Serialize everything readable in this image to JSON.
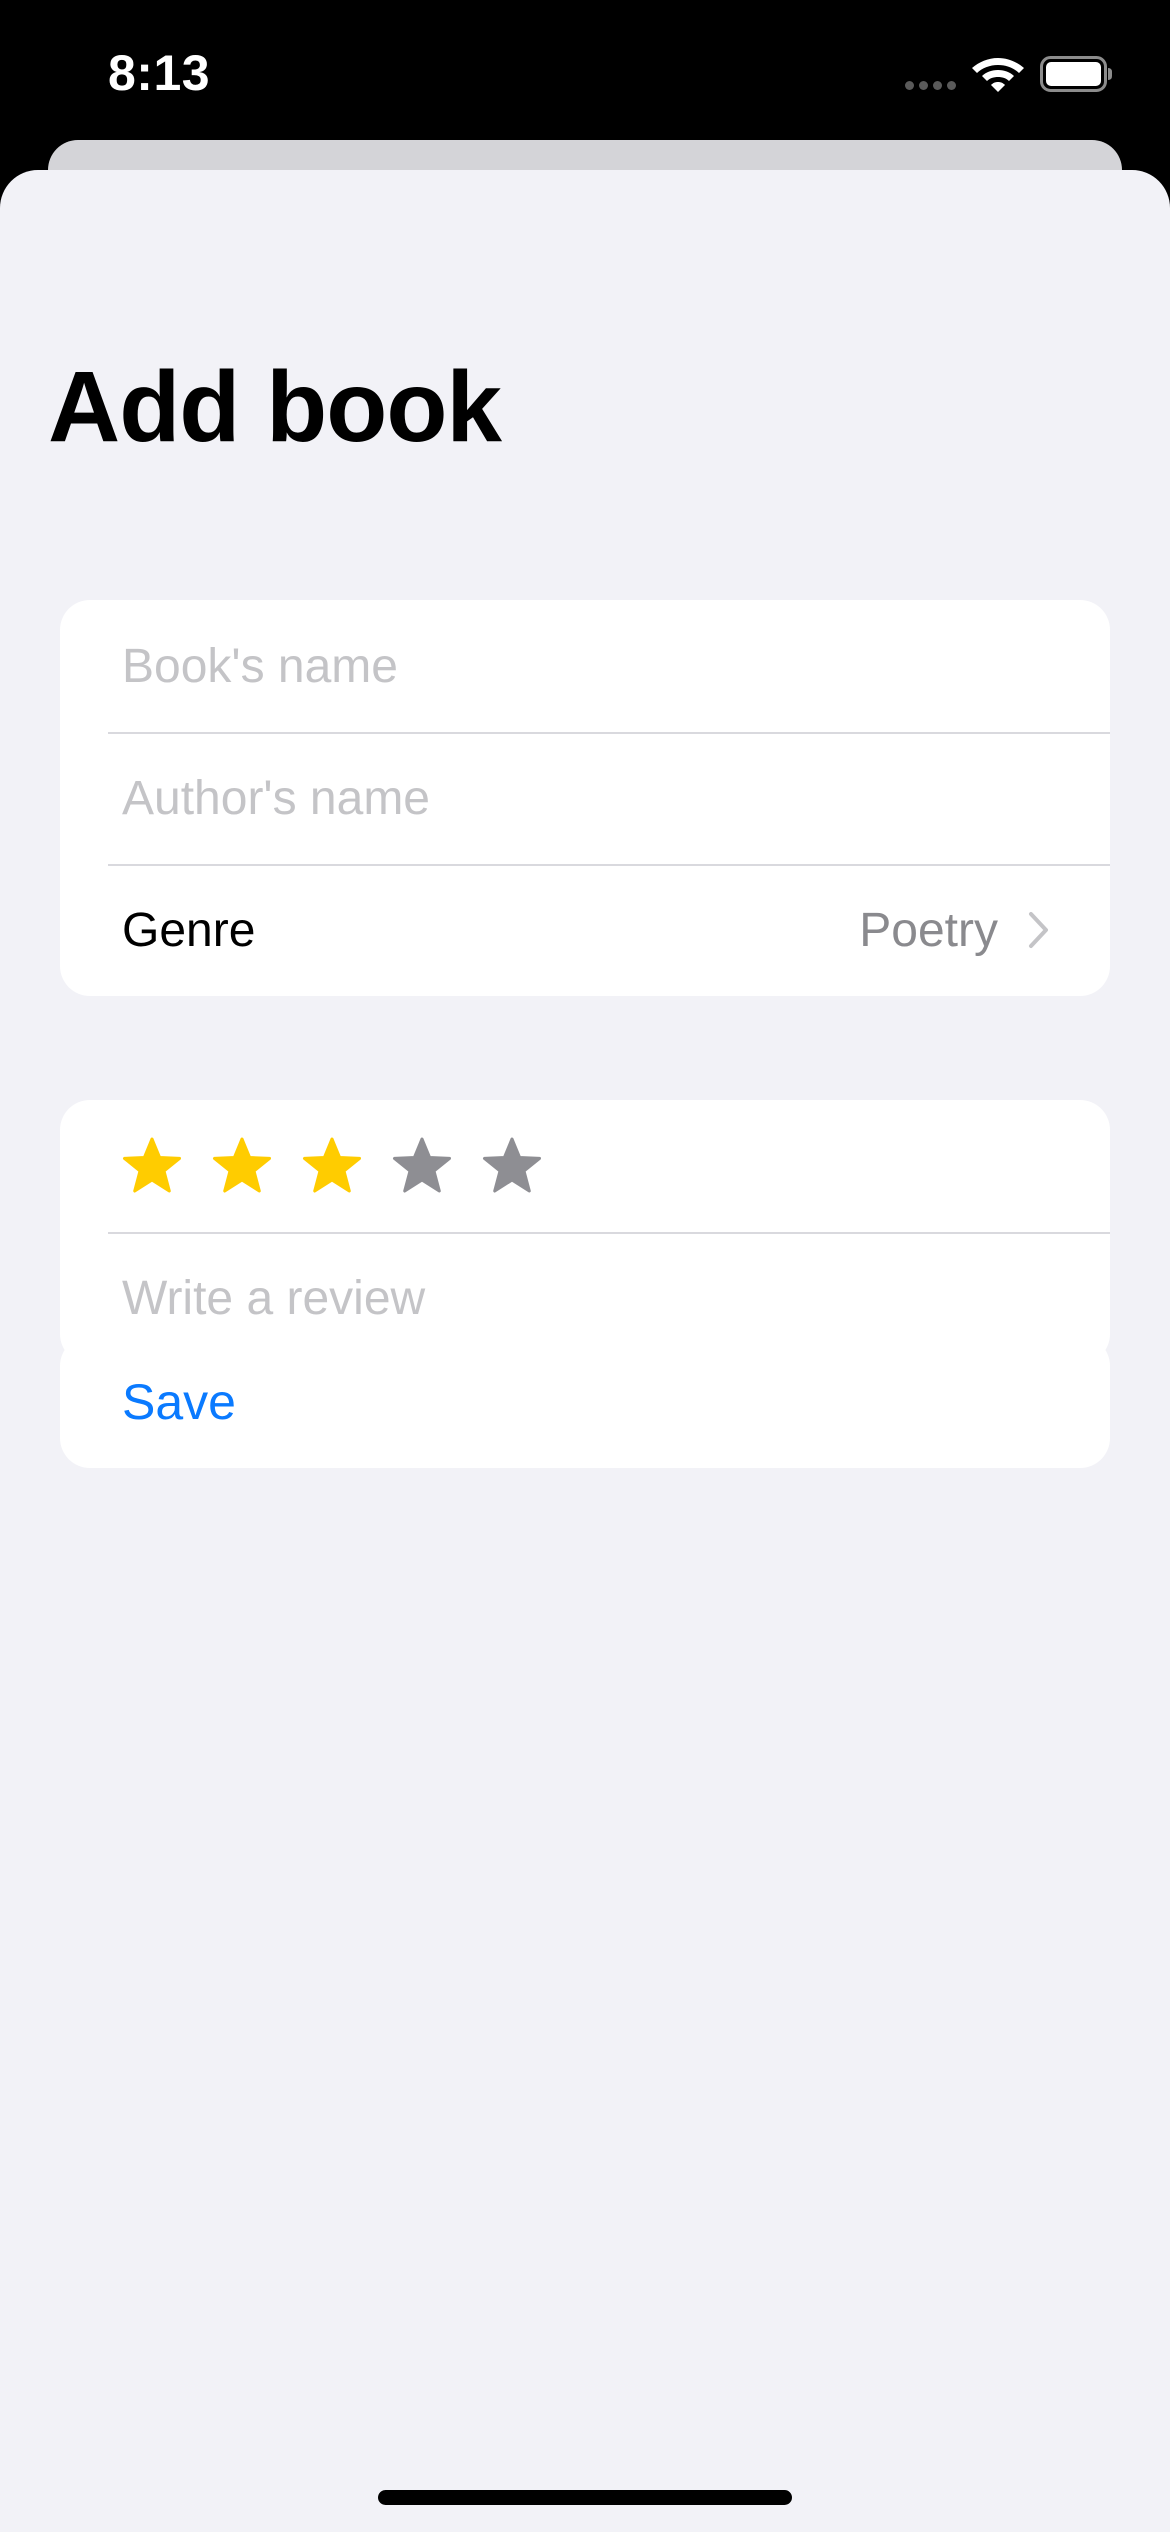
{
  "status_bar": {
    "time": "8:13",
    "wifi_icon": "wifi-icon",
    "battery_icon": "battery-icon"
  },
  "sheet": {
    "title": "Add book"
  },
  "form": {
    "book_name": {
      "value": "",
      "placeholder": "Book's name"
    },
    "author_name": {
      "value": "",
      "placeholder": "Author's name"
    },
    "genre": {
      "label": "Genre",
      "value": "Poetry",
      "icon": "chevron-right-icon"
    }
  },
  "review": {
    "rating": 3,
    "max_rating": 5,
    "filled_color": "#ffcc00",
    "empty_color": "#8e8e93",
    "placeholder": "Write a review",
    "value": ""
  },
  "actions": {
    "save_label": "Save",
    "accent_color": "#0a7aff"
  }
}
